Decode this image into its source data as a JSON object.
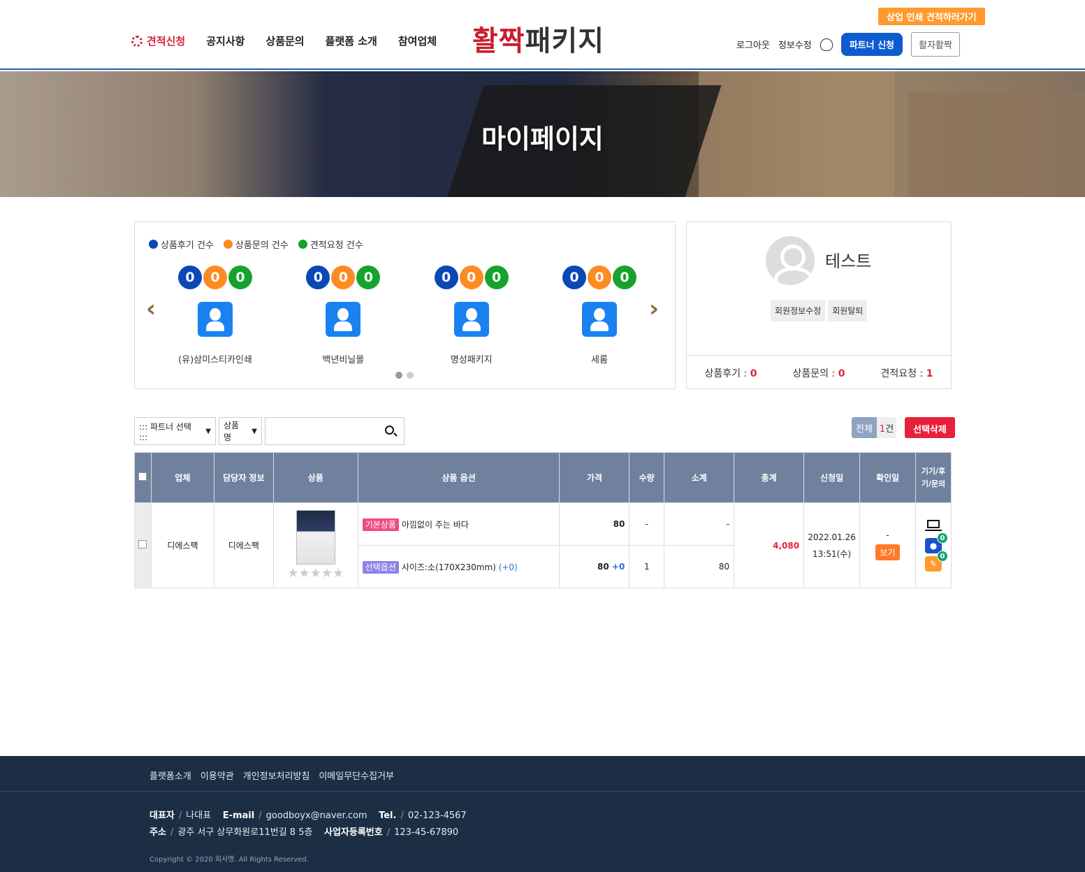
{
  "header": {
    "nav": [
      "견적신청",
      "공지사항",
      "상품문의",
      "플랫폼 소개",
      "참여업체"
    ],
    "logo_red": "활짝",
    "logo_dark": "패키지",
    "logout": "로그아웃",
    "edit_info": "정보수정",
    "partner_apply": "파트너 신청",
    "hwal_button": "활자활짝",
    "promo": "상업 인쇄 견적하러가기"
  },
  "hero": {
    "title": "마이페이지"
  },
  "stats": {
    "legend": [
      {
        "label": "상품후기 건수",
        "color": "#0a48b5"
      },
      {
        "label": "상품문의 건수",
        "color": "#ff8a24"
      },
      {
        "label": "견적요청 건수",
        "color": "#16a32c"
      }
    ],
    "partners": [
      {
        "name": "(유)삼미스티카인쇄",
        "counts": [
          "0",
          "0",
          "0"
        ]
      },
      {
        "name": "백년비닐몰",
        "counts": [
          "0",
          "0",
          "0"
        ]
      },
      {
        "name": "명성패키지",
        "counts": [
          "0",
          "0",
          "0"
        ]
      },
      {
        "name": "세롬",
        "counts": [
          "0",
          "0",
          "0"
        ]
      }
    ]
  },
  "profile": {
    "name": "테스트",
    "edit_button": "회원정보수정",
    "withdraw_button": "회원탈퇴",
    "review_label": "상품후기 : ",
    "review_count": "0",
    "inquiry_label": "상품문의 : ",
    "inquiry_count": "0",
    "quote_label": "견적요청 : ",
    "quote_count": "1"
  },
  "filters": {
    "partner_select": "::: 파트너 선택 :::",
    "field_select": "상품명",
    "total_label": "전체",
    "total_count": "1",
    "total_unit": "건",
    "delete_button": "선택삭제"
  },
  "table": {
    "headers": [
      "업체",
      "담당자 정보",
      "상품",
      "상품 옵션",
      "가격",
      "수량",
      "소계",
      "총계",
      "신청일",
      "확인일",
      "기기/후기/문의"
    ],
    "row": {
      "company": "디에스팩",
      "manager": "디에스팩",
      "basic_tag": "기본상품",
      "basic_name": "아낌없이 주는 바다",
      "basic_price": "80",
      "basic_qty": "-",
      "basic_subtotal": "-",
      "option_tag": "선택옵션",
      "option_name": "사이즈:소(170X230mm)",
      "option_plus": "(+0)",
      "option_price": "80",
      "option_price_plus": "+0",
      "option_qty": "1",
      "option_subtotal": "80",
      "total": "4,080",
      "date": "2022.01.26",
      "time": "13:51(수)",
      "confirm": "-",
      "view_button": "보기",
      "chat_badge": "0",
      "edit_badge": "0"
    }
  },
  "footer": {
    "links": [
      "플랫폼소개",
      "이용약관",
      "개인정보처리방침",
      "이메일무단수집거부"
    ],
    "ceo_label": "대표자",
    "ceo": "나대표",
    "email_label": "E-mail",
    "email": "goodboyx@naver.com",
    "tel_label": "Tel.",
    "tel": "02-123-4567",
    "addr_label": "주소",
    "addr": "광주 서구 상무화원로11번길 8 5층",
    "biz_label": "사업자등록번호",
    "biz": "123-45-67890",
    "copyright": "Copyright © 2020 회사명. All Rights Reserved."
  }
}
